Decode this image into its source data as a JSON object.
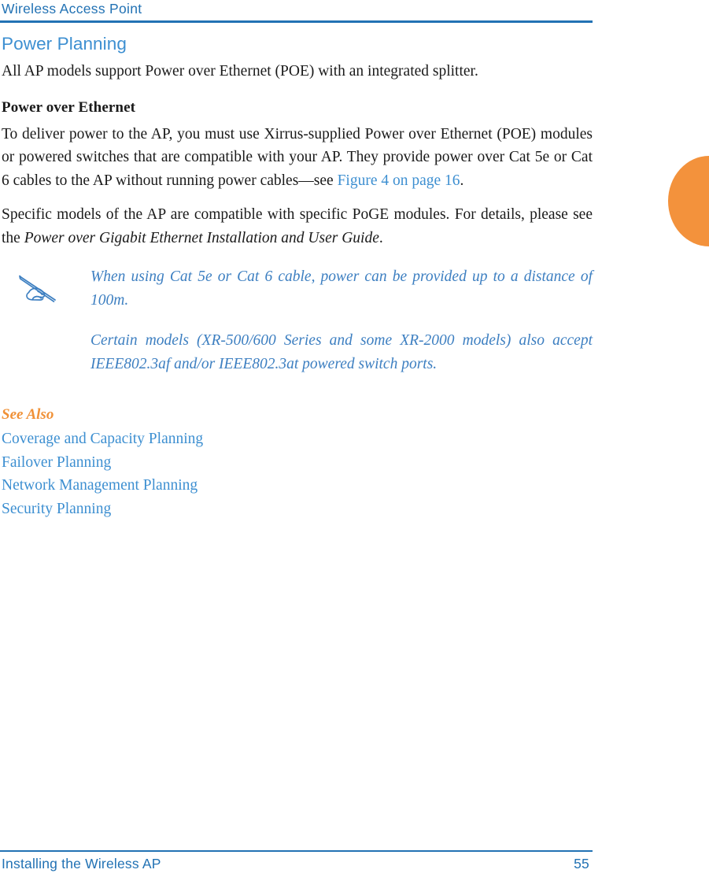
{
  "colors": {
    "header_blue": "#2272B4",
    "heading_blue": "#3D8FD1",
    "link_blue": "#3D8FD1",
    "note_blue": "#3D7FC1",
    "accent_orange": "#F09137",
    "tab_orange": "#F3923C",
    "body_text": "#1a1a1a"
  },
  "header": {
    "running_title": "Wireless Access Point"
  },
  "content": {
    "section_title": "Power Planning",
    "intro_paragraph": "All AP models support Power over Ethernet (POE) with an integrated splitter.",
    "subhead": "Power over Ethernet",
    "poe_paragraph_before_link": "To deliver power to the AP, you must use Xirrus-supplied Power over Ethernet (POE) modules or powered switches that are compatible with your AP. They provide power over Cat 5e or Cat 6 cables to the AP without running power cables—see ",
    "poe_link": "Figure 4 on page 16",
    "poe_paragraph_after_link": ".",
    "models_paragraph_before_italic": "Specific models of the AP are compatible with specific PoGE modules. For details, please see the ",
    "models_italic": "Power over Gigabit Ethernet Installation and User Guide",
    "models_paragraph_after_italic": "."
  },
  "note": {
    "icon_name": "note-hand-pen-icon",
    "paragraphs": [
      "When using Cat 5e or Cat 6 cable, power can be provided up to a distance of 100m.",
      "Certain models (XR-500/600 Series and some XR-2000 models) also accept IEEE802.3af and/or IEEE802.3at powered switch ports."
    ]
  },
  "see_also": {
    "title": "See Also",
    "links": [
      "Coverage and Capacity Planning",
      "Failover Planning",
      "Network Management Planning",
      "Security Planning"
    ]
  },
  "footer": {
    "chapter_title": "Installing the Wireless AP",
    "page_number": "55"
  }
}
